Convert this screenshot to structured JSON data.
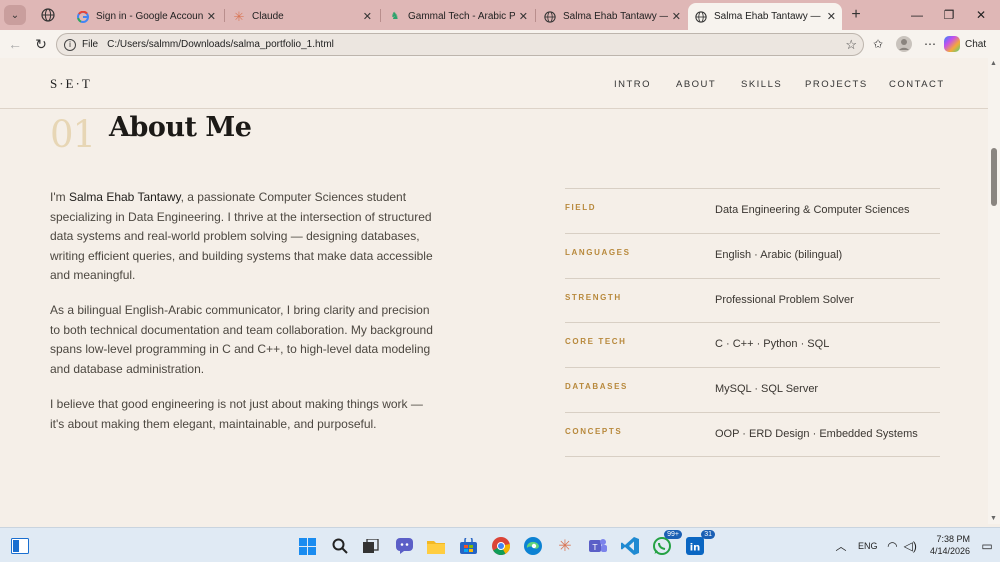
{
  "browser": {
    "tabs": [
      {
        "label": "Sign in - Google Accounts",
        "icon": "google-icon"
      },
      {
        "label": "Claude",
        "icon": "claude-icon"
      },
      {
        "label": "Gammal Tech - Arabic Progra",
        "icon": "gammal-tech-icon"
      },
      {
        "label": "Salma Ehab Tantawy — Portf",
        "icon": "globe-icon"
      },
      {
        "label": "Salma Ehab Tantawy — Portf",
        "icon": "globe-icon",
        "active": true
      }
    ],
    "address": {
      "scheme_label": "File",
      "url": "C:/Users/salmm/Downloads/salma_portfolio_1.html"
    },
    "chat_label": "Chat"
  },
  "site": {
    "logo": "S·E·T",
    "nav": [
      "INTRO",
      "ABOUT",
      "SKILLS",
      "PROJECTS",
      "CONTACT"
    ],
    "section_number": "01",
    "section_title": "About Me",
    "paragraphs": {
      "p1_prefix": "I'm ",
      "p1_name": "Salma Ehab Tantawy",
      "p1_rest": ", a passionate Computer Sciences student specializing in Data Engineering. I thrive at the intersection of structured data systems and real-world problem solving — designing databases, writing efficient queries, and building systems that make data accessible and meaningful.",
      "p2": "As a bilingual English-Arabic communicator, I bring clarity and precision to both technical documentation and team collaboration. My background spans low-level programming in C and C++, to high-level data modeling and database administration.",
      "p3": "I believe that good engineering is not just about making things work — it's about making them elegant, maintainable, and purposeful."
    },
    "facts": [
      {
        "key": "FIELD",
        "value": "Data Engineering & Computer Sciences"
      },
      {
        "key": "LANGUAGES",
        "value": "English · Arabic (bilingual)"
      },
      {
        "key": "STRENGTH",
        "value": "Professional Problem Solver"
      },
      {
        "key": "CORE TECH",
        "value": "C · C++ · Python · SQL"
      },
      {
        "key": "DATABASES",
        "value": "MySQL · SQL Server"
      },
      {
        "key": "CONCEPTS",
        "value": "OOP · ERD Design · Embedded Systems"
      }
    ]
  },
  "taskbar": {
    "whatsapp_badge": "99+",
    "linkedin_badge": "31",
    "language": "ENG",
    "time": "7:38 PM",
    "date": "4/14/2026"
  },
  "colors": {
    "accent_gold": "#b8893c",
    "section_number": "#e7d6b5",
    "page_bg": "#f5efe8",
    "tab_strip": "#dfb7b6"
  }
}
